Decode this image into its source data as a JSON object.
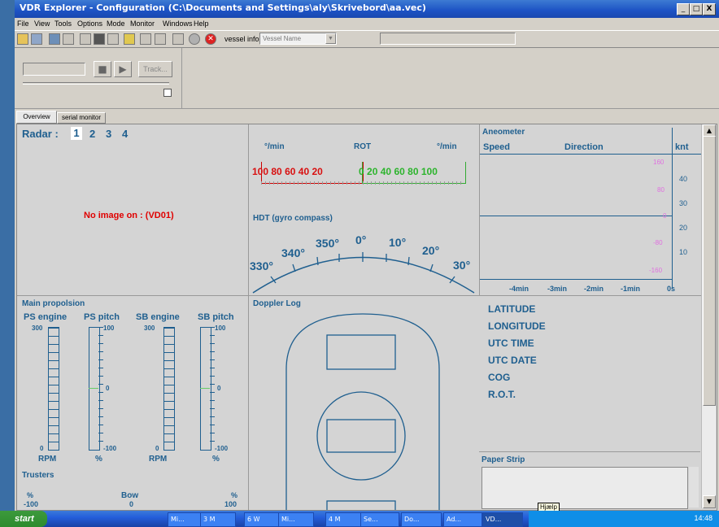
{
  "window": {
    "title": "VDR Explorer - Configuration (C:\\Documents and Settings\\aly\\Skrivebord\\aa.vec)",
    "buttons": [
      "_",
      "□",
      "X"
    ]
  },
  "menu": [
    "File",
    "View",
    "Tools",
    "Options",
    "Mode",
    "Monitor",
    "Windows",
    "Help"
  ],
  "toolbar": {
    "vessel_info_label": "vessel info:",
    "vessel_name": "Vessel Name"
  },
  "playback": {
    "track_label": "Track..."
  },
  "tabs": [
    "Overview",
    "serial monitor"
  ],
  "radar": {
    "label": "Radar :",
    "options": [
      "1",
      "2",
      "3",
      "4"
    ],
    "message": "No image on : (VD01)"
  },
  "rot": {
    "unit_left": "°/min",
    "title": "ROT",
    "unit_right": "°/min",
    "red_ticks": [
      "100",
      "80",
      "60",
      "40",
      "20"
    ],
    "green_ticks": [
      "0",
      "20",
      "40",
      "60",
      "80",
      "100"
    ]
  },
  "hdt": {
    "title": "HDT (gyro compass)",
    "labels": [
      "330°",
      "340°",
      "350°",
      "0°",
      "10°",
      "20°",
      "30°"
    ]
  },
  "anemometer": {
    "title": "Aneometer",
    "speed": "Speed",
    "direction": "Direction",
    "unit": "knt",
    "scale_right": [
      "40",
      "30",
      "20",
      "10"
    ],
    "scale_left": [
      "160",
      "80",
      "0",
      "-80",
      "-160"
    ],
    "time_labels": [
      "-4min",
      "-3min",
      "-2min",
      "-1min",
      "0s"
    ]
  },
  "navinfo": {
    "items": [
      "LATITUDE",
      "LONGITUDE",
      "UTC TIME",
      "UTC DATE",
      "COG",
      "R.O.T."
    ]
  },
  "propulsion": {
    "title": "Main propolsion",
    "gauges": [
      {
        "label": "PS engine",
        "top": "300",
        "bottom": "0",
        "unit": "RPM"
      },
      {
        "label": "PS pitch",
        "top": "100",
        "mid": "0",
        "bottom": "-100",
        "unit": "%"
      },
      {
        "label": "SB engine",
        "top": "300",
        "bottom": "0",
        "unit": "RPM"
      },
      {
        "label": "SB pitch",
        "top": "100",
        "mid": "0",
        "bottom": "-100",
        "unit": "%"
      }
    ],
    "thrusters": {
      "title": "Trusters",
      "left_unit": "%",
      "left_value": "-100",
      "center_label": "Bow",
      "center_value": "0",
      "right_unit": "%",
      "right_value": "100"
    }
  },
  "doppler": {
    "title": "Doppler Log"
  },
  "paper": {
    "title": "Paper Strip",
    "tooltip": "Hjælp"
  },
  "taskbar": {
    "start": "start",
    "tasks": [
      "Mi...",
      "3 M",
      "6 W",
      "Mi...",
      "4 M",
      "Se...",
      "Do...",
      "Ad...",
      "VD..."
    ],
    "clock": "14:48"
  }
}
